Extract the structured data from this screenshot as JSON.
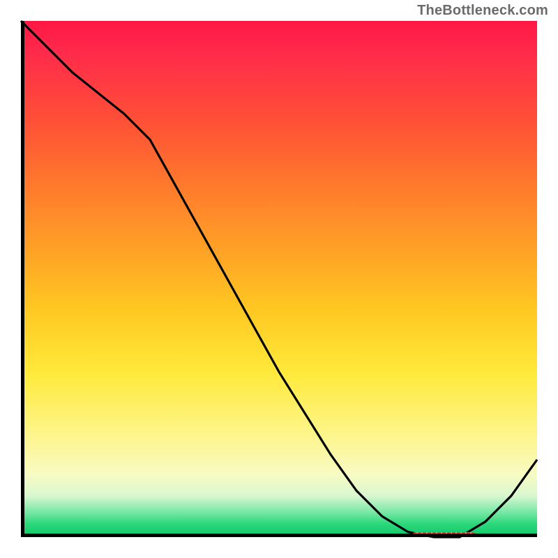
{
  "attribution": "TheBottleneck.com",
  "colors": {
    "gradient_top": "#ff1744",
    "gradient_mid": "#ffe93a",
    "gradient_bottom": "#0ec86b",
    "curve": "#000000",
    "axis": "#000000",
    "valley_marker": "#e53935"
  },
  "chart_data": {
    "type": "line",
    "title": "",
    "xlabel": "",
    "ylabel": "",
    "xlim": [
      0,
      100
    ],
    "ylim": [
      0,
      100
    ],
    "grid": false,
    "legend": false,
    "series": [
      {
        "name": "curve",
        "x": [
          0,
          5,
          10,
          15,
          20,
          25,
          30,
          35,
          40,
          45,
          50,
          55,
          60,
          65,
          70,
          75,
          80,
          85,
          90,
          95,
          100
        ],
        "y": [
          100,
          95,
          90,
          86,
          82,
          77,
          68,
          59,
          50,
          41,
          32,
          24,
          16,
          9,
          4,
          1,
          0,
          0,
          3,
          8,
          15
        ]
      }
    ],
    "valley_marker_x_range": [
      76,
      88
    ],
    "valley_marker_y": 0.5
  }
}
